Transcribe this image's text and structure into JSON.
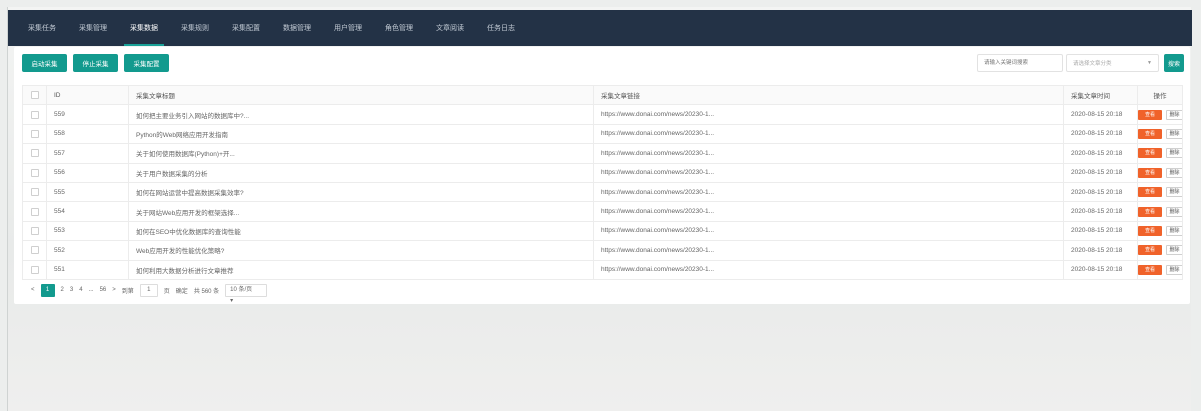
{
  "nav": {
    "tabs": [
      {
        "label": "采集任务"
      },
      {
        "label": "采集管理"
      },
      {
        "label": "采集数据"
      },
      {
        "label": "采集规则"
      },
      {
        "label": "采集配置"
      },
      {
        "label": "数据管理"
      },
      {
        "label": "用户管理"
      },
      {
        "label": "角色管理"
      },
      {
        "label": "文章阅读"
      },
      {
        "label": "任务日志"
      }
    ],
    "active_index": 2
  },
  "toolbar": {
    "button1": "启动采集",
    "button2": "停止采集",
    "button3": "采集配置",
    "search_placeholder": "请输入关键词搜索",
    "select_placeholder": "请选择文章分类",
    "search_button": "搜索"
  },
  "table": {
    "headers": {
      "id": "ID",
      "title": "采集文章标题",
      "link": "采集文章链接",
      "time": "采集文章时间",
      "action": "操作"
    },
    "rows": [
      {
        "id": "559",
        "title": "如何把主要业务引入网站的数据库中?...",
        "link": "https://www.donai.com/news/20230-1...",
        "time": "2020-08-15 20:18"
      },
      {
        "id": "558",
        "title": "Python的Web网络应用开发指南",
        "link": "https://www.donai.com/news/20230-1...",
        "time": "2020-08-15 20:18"
      },
      {
        "id": "557",
        "title": "关于如何使用数据库(Python)+开...",
        "link": "https://www.donai.com/news/20230-1...",
        "time": "2020-08-15 20:18"
      },
      {
        "id": "556",
        "title": "关于用户数据采集的分析",
        "link": "https://www.donai.com/news/20230-1...",
        "time": "2020-08-15 20:18"
      },
      {
        "id": "555",
        "title": "如何在网站运营中提高数据采集效率?",
        "link": "https://www.donai.com/news/20230-1...",
        "time": "2020-08-15 20:18"
      },
      {
        "id": "554",
        "title": "关于网站Web应用开发的框架选择...",
        "link": "https://www.donai.com/news/20230-1...",
        "time": "2020-08-15 20:18"
      },
      {
        "id": "553",
        "title": "如何在SEO中优化数据库的查询性能",
        "link": "https://www.donai.com/news/20230-1...",
        "time": "2020-08-15 20:18"
      },
      {
        "id": "552",
        "title": "Web应用开发的性能优化策略?",
        "link": "https://www.donai.com/news/20230-1...",
        "time": "2020-08-15 20:18"
      },
      {
        "id": "551",
        "title": "如何利用大数据分析进行文章推荐",
        "link": "https://www.donai.com/news/20230-1...",
        "time": "2020-08-15 20:18"
      }
    ],
    "row_action_primary": "查看",
    "row_action_secondary": "删除"
  },
  "pagination": {
    "prev": "<",
    "pages": [
      "1",
      "2",
      "3",
      "4"
    ],
    "ellipsis": "...",
    "last": "56",
    "next": ">",
    "goto_label": "到第",
    "goto_value": "1",
    "goto_unit": "页",
    "confirm": "确定",
    "total": "共 560 条",
    "page_size": "10 条/页"
  }
}
